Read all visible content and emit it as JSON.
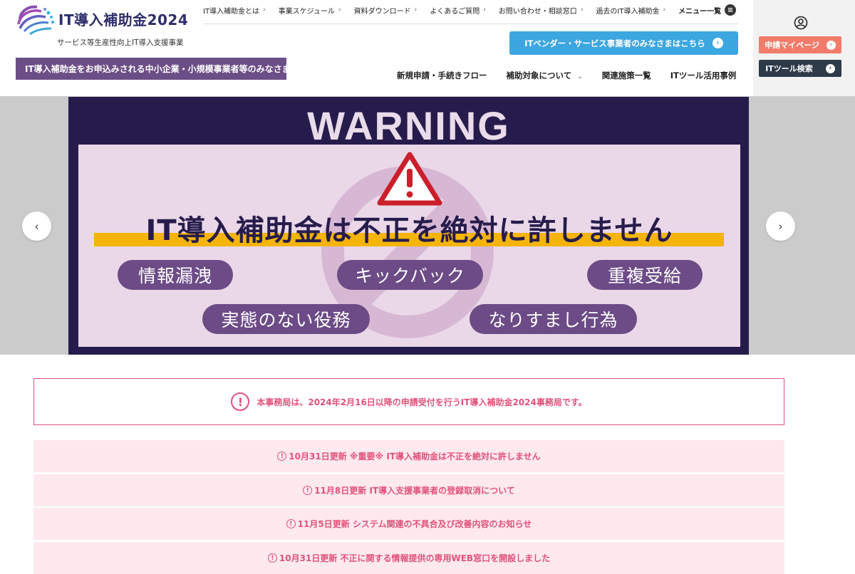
{
  "header": {
    "logo_text": "IT導入補助金2024",
    "logo_sub": "サービス等生産性向上IT導入支援事業",
    "audience_banner": "IT導入補助金をお申込みされる中小企業・小規模事業者等のみなさま",
    "top_nav": [
      {
        "label": "IT導入補助金とは"
      },
      {
        "label": "事業スケジュール"
      },
      {
        "label": "資料ダウンロード"
      },
      {
        "label": "よくあるご質問"
      },
      {
        "label": "お問い合わせ・相談窓口"
      },
      {
        "label": "過去のIT導入補助金"
      }
    ],
    "menu_label": "メニュー一覧",
    "vendor_button": "ITベンダー・サービス事業者のみなさまはこちら",
    "main_nav": [
      {
        "label": "新規申請・手続きフロー"
      },
      {
        "label": "補助対象について"
      },
      {
        "label": "関連施策一覧"
      },
      {
        "label": "ITツール活用事例"
      }
    ],
    "mypage_button": "申請マイページ",
    "tool_search_button": "ITツール検索",
    "icons": {
      "chevron": "chevron-right-icon",
      "menu": "hamburger-icon",
      "user": "user-icon",
      "arrow": "circle-arrow-right-icon"
    }
  },
  "carousel": {
    "warning_title": "WARNING",
    "headline": "IT導入補助金は不正を絶対に許しません",
    "tags": [
      "情報漏洩",
      "キックバック",
      "重複受給",
      "実態のない役務",
      "なりすまし行為"
    ],
    "prev_icon": "chevron-left-icon",
    "next_icon": "chevron-right-icon"
  },
  "notice": {
    "text": "本事務局は、2024年2月16日以降の申請受付を行うIT導入補助金2024事務局です。",
    "icon": "!"
  },
  "updates": [
    {
      "text": "10月31日更新 ※重要※ IT導入補助金は不正を絶対に許しません"
    },
    {
      "text": "11月8日更新 IT導入支援事業者の登録取消について"
    },
    {
      "text": "11月5日更新 システム関連の不具合及び改善内容のお知らせ"
    },
    {
      "text": "10月31日更新 不正に関する情報提供の専用WEB窓口を開設しました"
    }
  ],
  "colors": {
    "brand_purple": "#6c4e86",
    "navy": "#261c4c",
    "accent_blue": "#3ba6e0",
    "coral": "#f27b6a",
    "notice_pink": "#e2527a",
    "highlight_yellow": "#f5b40a"
  }
}
